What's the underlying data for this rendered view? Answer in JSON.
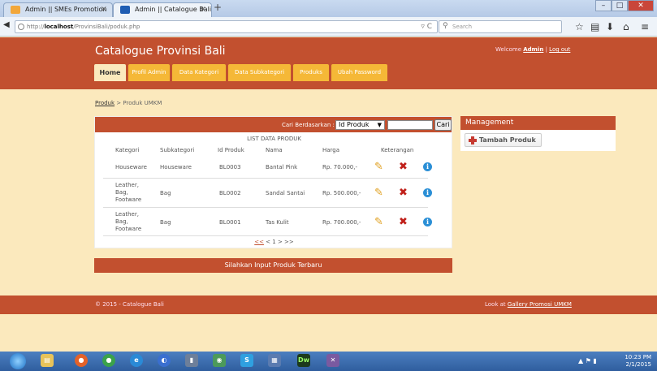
{
  "browser": {
    "tabs": [
      {
        "label": "Admin || SMEs Promotion",
        "active": false
      },
      {
        "label": "Admin || Catalogue Bali",
        "active": true
      }
    ],
    "new_tab": "+",
    "url_prefix": "http://",
    "url_host": "localhost",
    "url_path": "/ProvinsiBali/poduk.php",
    "search_placeholder": "Search",
    "back": "◀",
    "reload": "▿ C"
  },
  "header": {
    "site_title": "Catalogue Provinsi Bali",
    "welcome_prefix": "Welcome ",
    "username": "Admin",
    "separator": " | ",
    "logout": "Log out"
  },
  "nav": {
    "tabs": [
      {
        "label": "Home",
        "active": true
      },
      {
        "label": "Profil Admin"
      },
      {
        "label": "Data Kategori"
      },
      {
        "label": "Data Subkategori"
      },
      {
        "label": "Produks"
      },
      {
        "label": "Ubah Password"
      }
    ]
  },
  "breadcrumb": {
    "link": "Produk",
    "sep": " > ",
    "current": "Produk UMKM"
  },
  "search": {
    "label": "Cari Berdasarkan :",
    "selected": "Id Produk",
    "query": "",
    "button": "Cari"
  },
  "table": {
    "title": "LIST DATA PRODUK",
    "headers": [
      "Kategori",
      "Subkategori",
      "Id Produk",
      "Nama",
      "Harga",
      "Keterangan"
    ],
    "rows": [
      {
        "kategori": "Houseware",
        "subkategori": "Houseware",
        "id": "BL0003",
        "nama": "Bantal Pink",
        "harga": "Rp. 70.000,-"
      },
      {
        "kategori": "Leather, Bag, Footware",
        "subkategori": "Bag",
        "id": "BL0002",
        "nama": "Sandal Santai",
        "harga": "Rp. 500.000,-"
      },
      {
        "kategori": "Leather, Bag, Footware",
        "subkategori": "Bag",
        "id": "BL0001",
        "nama": "Tas Kulit",
        "harga": "Rp. 700.000,-"
      }
    ],
    "pager_prev": "<<",
    "pager_mid": " < 1 > >>"
  },
  "input_bar": "Silahkan Input Produk Terbaru",
  "management": {
    "title": "Management",
    "add_button": "Tambah Produk"
  },
  "footer": {
    "copyright": "© 2015 - Catalogue Bali",
    "look_prefix": "Look at ",
    "look_link": "Gallery Promosi UMKM"
  },
  "taskbar": {
    "time": "10:23 PM",
    "date": "2/1/2015",
    "app_dw": "Dw"
  },
  "colors": {
    "brand": "#c2502f",
    "tab": "#f5b837",
    "page_bg": "#fbe9bd"
  }
}
